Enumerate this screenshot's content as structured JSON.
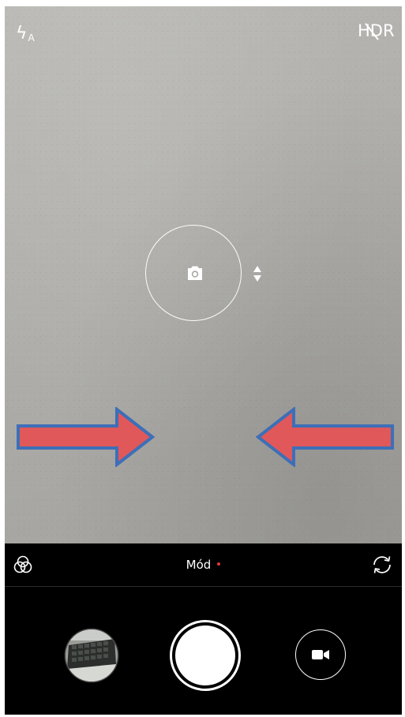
{
  "top_bar": {
    "flash_mode_suffix": "A",
    "hdr_label": "HDR",
    "hdr_enabled": false
  },
  "viewfinder": {
    "focus_indicator_icon": "camera-icon",
    "exposure_handle_icon": "up-down-triangles-icon",
    "annotation_arrow_color": "#e0585a",
    "annotation_arrow_outline": "#3d6fb8"
  },
  "mode_bar": {
    "mode_label": "Mód",
    "mode_dot_color": "#e53935",
    "left_icon": "filters-icon",
    "right_icon": "switch-camera-icon"
  },
  "shutter_bar": {
    "gallery_icon": "gallery-thumbnail",
    "shutter_icon": "shutter-button",
    "video_icon": "video-camera-icon"
  }
}
